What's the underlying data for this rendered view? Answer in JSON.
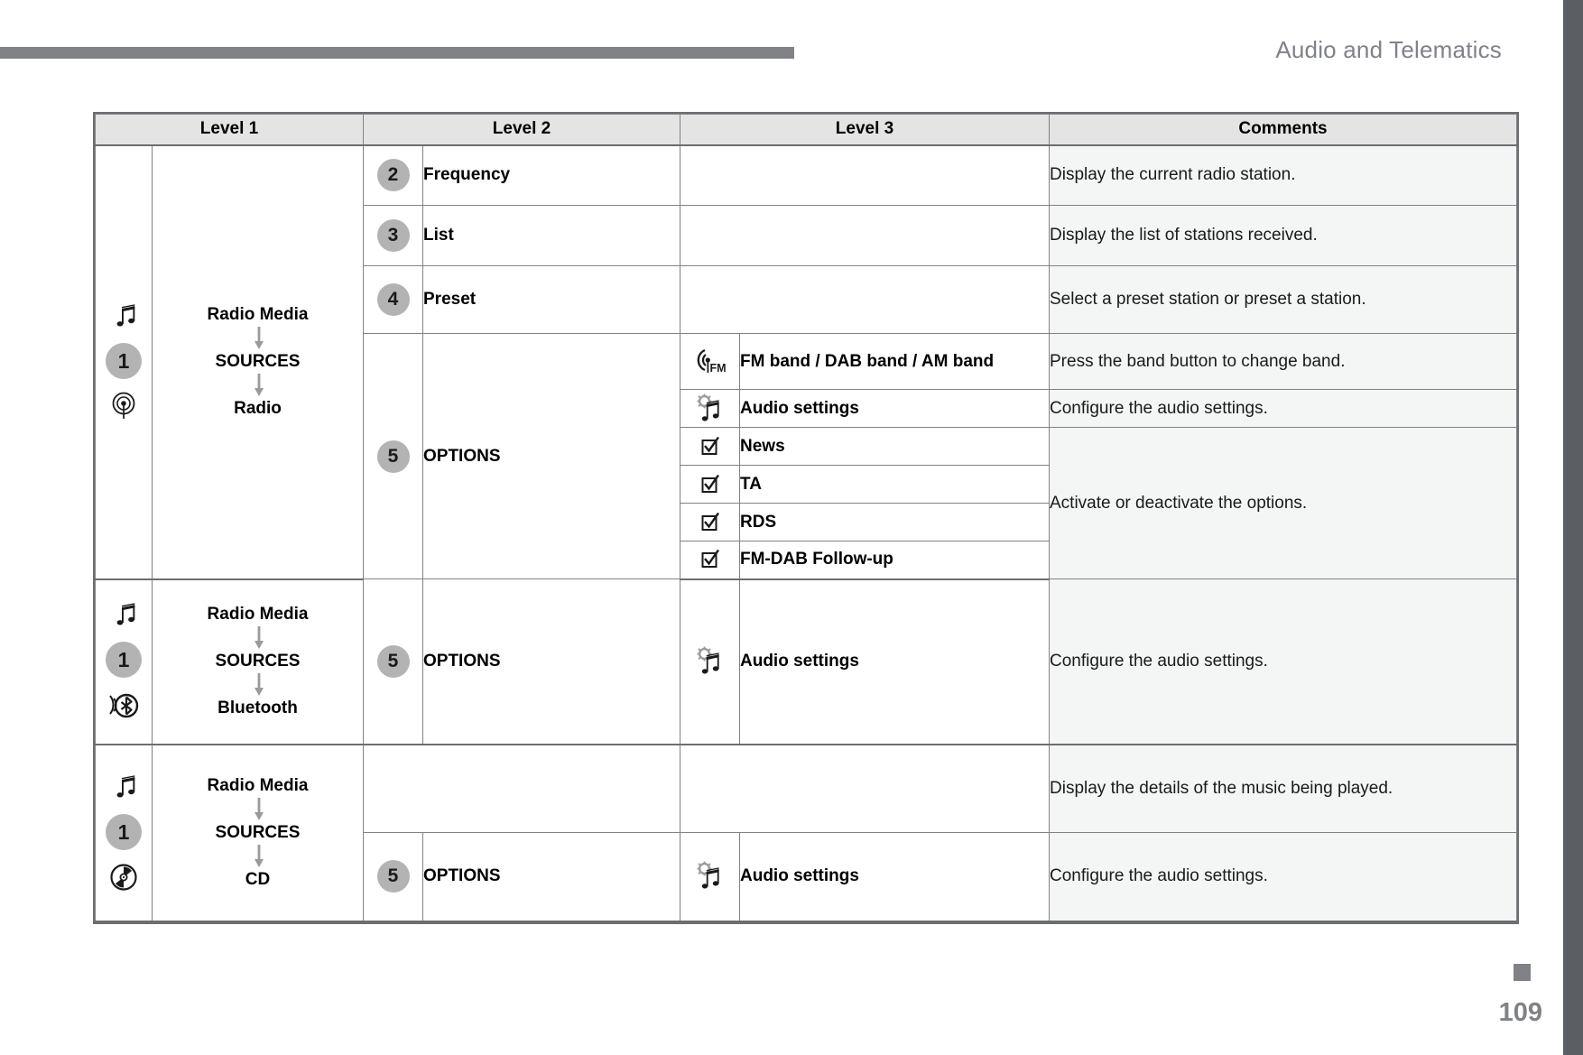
{
  "header": {
    "title": "Audio and Telematics"
  },
  "footer": {
    "page_number": "109"
  },
  "colors": {
    "edge_bar": "#5b5e63",
    "top_rule": "#808285",
    "header_text": "#808289",
    "table_border": "#808285",
    "header_row_bg": "#e4e4e4",
    "comments_bg": "#f4f5f5",
    "badge_bg": "#b3b3b3"
  },
  "table": {
    "columns": [
      "Level 1",
      "Level 2",
      "Level 3",
      "Comments"
    ],
    "sections": [
      {
        "id": "radio",
        "source_icons": [
          "music-note-icon",
          "badge-1",
          "radio-antenna-icon"
        ],
        "badge": "1",
        "flow": [
          "Radio Media",
          "SOURCES",
          "Radio"
        ],
        "rows": [
          {
            "num": "2",
            "level2": "Frequency",
            "level3": [],
            "comment": "Display the current radio station."
          },
          {
            "num": "3",
            "level2": "List",
            "level3": [],
            "comment": "Display the list of stations received."
          },
          {
            "num": "4",
            "level2": "Preset",
            "level3": [],
            "comment": "Select a preset station or preset a station."
          },
          {
            "num": "5",
            "level2": "OPTIONS",
            "level3": [
              {
                "icon": "fm-band-icon",
                "label": "FM band / DAB band / AM band",
                "comment": "Press the band button to change band.",
                "comment_rowspan": 1
              },
              {
                "icon": "audio-settings-icon",
                "label": "Audio settings",
                "comment": "Configure the audio settings.",
                "comment_rowspan": 1
              },
              {
                "icon": "checkbox-icon",
                "label": "News",
                "comment": "Activate or deactivate the options.",
                "comment_rowspan": 4
              },
              {
                "icon": "checkbox-icon",
                "label": "TA",
                "comment": null,
                "comment_rowspan": 0
              },
              {
                "icon": "checkbox-icon",
                "label": "RDS",
                "comment": null,
                "comment_rowspan": 0
              },
              {
                "icon": "checkbox-icon",
                "label": "FM-DAB Follow-up",
                "comment": null,
                "comment_rowspan": 0
              }
            ]
          }
        ]
      },
      {
        "id": "bluetooth",
        "source_icons": [
          "music-note-icon",
          "badge-1",
          "bluetooth-icon"
        ],
        "badge": "1",
        "flow": [
          "Radio Media",
          "SOURCES",
          "Bluetooth"
        ],
        "rows": [
          {
            "num": "5",
            "level2": "OPTIONS",
            "level3": [
              {
                "icon": "audio-settings-icon",
                "label": "Audio settings",
                "comment": "Configure the audio settings.",
                "comment_rowspan": 1
              }
            ]
          }
        ]
      },
      {
        "id": "cd",
        "source_icons": [
          "music-note-icon",
          "badge-1",
          "cd-disc-icon"
        ],
        "badge": "1",
        "flow": [
          "Radio Media",
          "SOURCES",
          "CD"
        ],
        "rows": [
          {
            "num": "",
            "level2": "",
            "level3": [],
            "comment": "Display the details of the music being played."
          },
          {
            "num": "5",
            "level2": "OPTIONS",
            "level3": [
              {
                "icon": "audio-settings-icon",
                "label": "Audio settings",
                "comment": "Configure the audio settings.",
                "comment_rowspan": 1
              }
            ]
          }
        ]
      }
    ]
  }
}
